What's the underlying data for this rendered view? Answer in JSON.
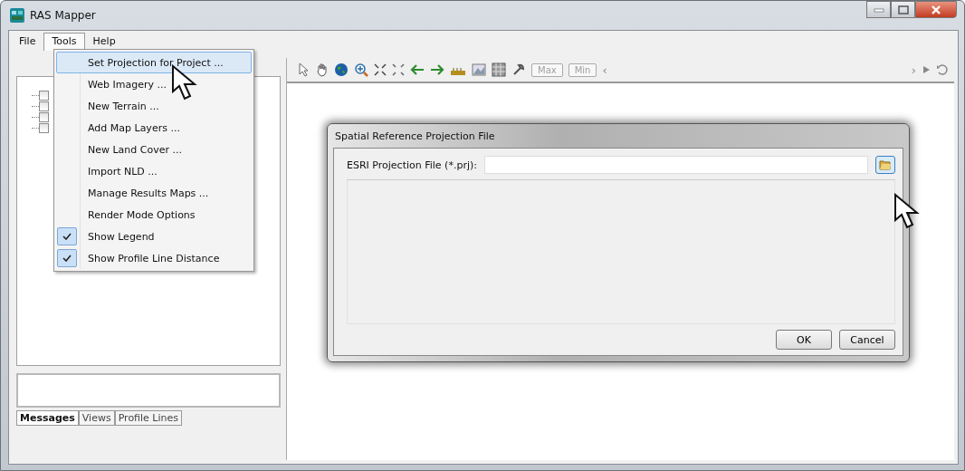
{
  "window": {
    "title": "RAS Mapper"
  },
  "menu_bar": [
    {
      "label": "File",
      "selected": false
    },
    {
      "label": "Tools",
      "selected": true
    },
    {
      "label": "Help",
      "selected": false
    }
  ],
  "tools_menu": [
    {
      "label": "Set Projection for Project ...",
      "selected": true,
      "kind": "command"
    },
    {
      "label": "Web Imagery ...",
      "selected": false,
      "kind": "command"
    },
    {
      "label": "New Terrain ...",
      "selected": false,
      "kind": "command"
    },
    {
      "label": "Add Map Layers ...",
      "selected": false,
      "kind": "command"
    },
    {
      "label": "New Land Cover ...",
      "selected": false,
      "kind": "command"
    },
    {
      "label": "Import NLD ...",
      "selected": false,
      "kind": "command"
    },
    {
      "label": "Manage Results Maps ...",
      "selected": false,
      "kind": "command"
    },
    {
      "label": "Render Mode Options",
      "selected": false,
      "kind": "command"
    },
    {
      "label": "Show Legend",
      "selected": false,
      "kind": "toggle",
      "checked": true
    },
    {
      "label": "Show Profile Line Distance",
      "selected": false,
      "kind": "toggle",
      "checked": true
    }
  ],
  "layer_tree": [
    {
      "checked": false
    },
    {
      "checked": false
    },
    {
      "checked": false
    },
    {
      "checked": false
    }
  ],
  "toolbar": {
    "buttons": [
      {
        "label": "Max",
        "disabled": true
      },
      {
        "label": "Min",
        "disabled": true
      }
    ],
    "scroll_left": "‹",
    "scroll_right": "›"
  },
  "bottom_tabs": [
    {
      "label": "Messages",
      "selected": true
    },
    {
      "label": "Views",
      "selected": false
    },
    {
      "label": "Profile Lines",
      "selected": false
    }
  ],
  "dialog": {
    "title": "Spatial Reference Projection File",
    "field_label": "ESRI Projection File (*.prj):",
    "buttons": [
      "OK",
      "Cancel"
    ]
  }
}
